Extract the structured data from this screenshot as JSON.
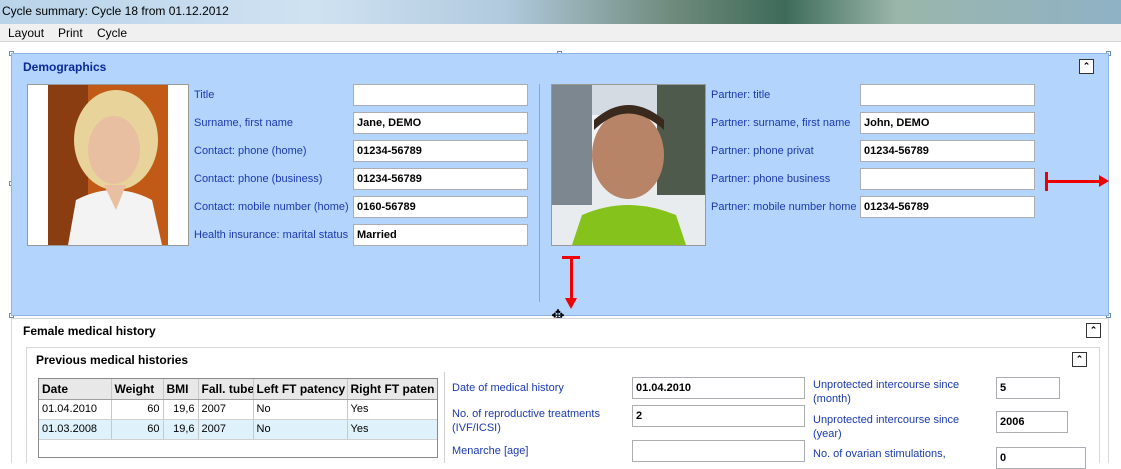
{
  "window": {
    "title": "Cycle summary: Cycle 18 from 01.12.2012"
  },
  "menu": [
    "Layout",
    "Print",
    "Cycle"
  ],
  "demographics": {
    "title": "Demographics",
    "left_labels": [
      "Title",
      "Surname, first name",
      "Contact: phone (home)",
      "Contact: phone (business)",
      "Contact: mobile number (home)",
      "Health insurance: marital status"
    ],
    "left_values": [
      "",
      "Jane, DEMO",
      "01234-56789",
      "01234-56789",
      "0160-56789",
      "Married"
    ],
    "right_labels": [
      "Partner: title",
      "Partner: surname, first name",
      "Partner: phone privat",
      "Partner: phone business",
      "Partner: mobile number home"
    ],
    "right_values": [
      "",
      "John, DEMO",
      "01234-56789",
      "",
      "01234-56789"
    ]
  },
  "female": {
    "title": "Female medical history"
  },
  "previous": {
    "title": "Previous medical histories",
    "columns": [
      "Date",
      "Weight",
      "BMI",
      "Fall. tube",
      "Left FT patency",
      "Right FT paten"
    ],
    "rows": [
      [
        "01.04.2010",
        "60",
        "19,6",
        "2007",
        "No",
        "Yes"
      ],
      [
        "01.03.2008",
        "60",
        "19,6",
        "2007",
        "No",
        "Yes"
      ]
    ],
    "mid_labels": [
      "Date of medical history",
      "No. of reproductive treatments (IVF/ICSI)",
      "Menarche [age]"
    ],
    "mid_values": [
      "01.04.2010",
      "2",
      ""
    ],
    "right_labels": [
      "Unprotected intercourse since (month)",
      "Unprotected intercourse since (year)",
      "No. of ovarian stimulations,"
    ],
    "right_values": [
      "5",
      "2006",
      "0"
    ]
  }
}
